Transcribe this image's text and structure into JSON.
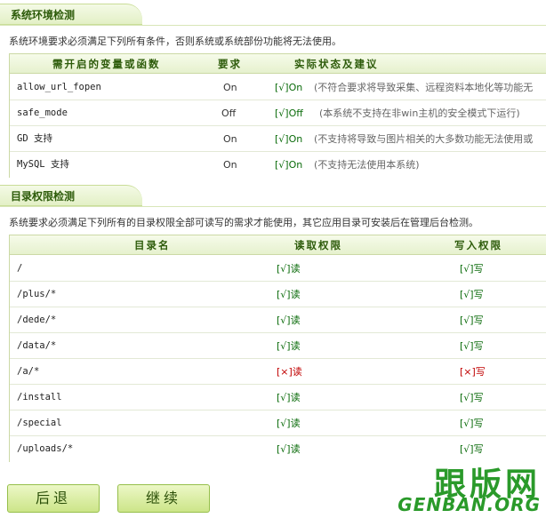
{
  "env_section": {
    "title": "系统环境检测",
    "desc": "系统环境要求必须满足下列所有条件，否则系统或系统部份功能将无法使用。",
    "headers": [
      "需开启的变量或函数",
      "要求",
      "实际状态及建议"
    ],
    "rows": [
      {
        "name": "allow_url_fopen",
        "req": "On",
        "status": "[√]On",
        "note": "(不符合要求将导致采集、远程资料本地化等功能无"
      },
      {
        "name": "safe_mode",
        "req": "Off",
        "status": "[√]Off",
        "note": "(本系统不支持在非win主机的安全模式下运行)"
      },
      {
        "name": "GD 支持",
        "req": "On",
        "status": "[√]On",
        "note": "(不支持将导致与图片相关的大多数功能无法使用或"
      },
      {
        "name": "MySQL 支持",
        "req": "On",
        "status": "[√]On",
        "note": "(不支持无法使用本系统)"
      }
    ]
  },
  "dir_section": {
    "title": "目录权限检测",
    "desc": "系统要求必须满足下列所有的目录权限全部可读写的需求才能使用，其它应用目录可安装后在管理后台检测。",
    "headers": [
      "目录名",
      "读取权限",
      "写入权限"
    ],
    "rows": [
      {
        "dir": "/",
        "read": "[√]读",
        "write": "[√]写",
        "ok": true
      },
      {
        "dir": "/plus/*",
        "read": "[√]读",
        "write": "[√]写",
        "ok": true
      },
      {
        "dir": "/dede/*",
        "read": "[√]读",
        "write": "[√]写",
        "ok": true
      },
      {
        "dir": "/data/*",
        "read": "[√]读",
        "write": "[√]写",
        "ok": true
      },
      {
        "dir": "/a/*",
        "read": "[×]读",
        "write": "[×]写",
        "ok": false
      },
      {
        "dir": "/install",
        "read": "[√]读",
        "write": "[√]写",
        "ok": true
      },
      {
        "dir": "/special",
        "read": "[√]读",
        "write": "[√]写",
        "ok": true
      },
      {
        "dir": "/uploads/*",
        "read": "[√]读",
        "write": "[√]写",
        "ok": true
      }
    ]
  },
  "buttons": {
    "back": "后退",
    "next": "继续"
  },
  "watermark": {
    "cn": "跟版网",
    "en": "GENBAN.ORG"
  },
  "colors": {
    "ok": "#0a6b0a",
    "bad": "#c00000",
    "accent": "#2d5b0a",
    "watermark": "#2a9a2a"
  }
}
